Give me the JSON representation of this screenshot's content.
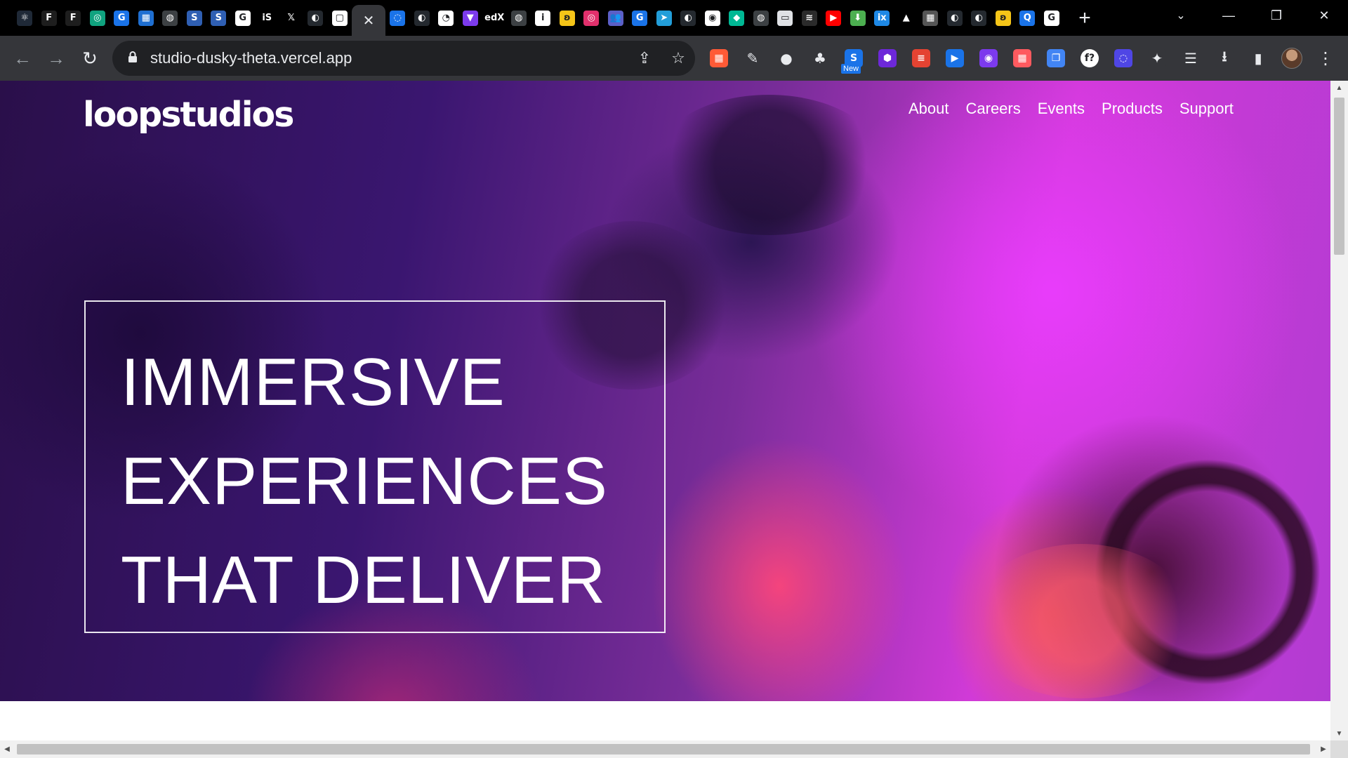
{
  "browser": {
    "tabs": [
      {
        "icon": "react-icon",
        "color": "#1f2937",
        "glyph": "⚛"
      },
      {
        "icon": "figma-icon",
        "color": "#1e1e1e",
        "glyph": "F"
      },
      {
        "icon": "figma-icon",
        "color": "#1e1e1e",
        "glyph": "F"
      },
      {
        "icon": "chatgpt-icon",
        "color": "#10a37f",
        "glyph": "◎"
      },
      {
        "icon": "grammarly-icon",
        "color": "#1a73e8",
        "glyph": "G"
      },
      {
        "icon": "windows-icon",
        "color": "#1f6fd1",
        "glyph": "▦"
      },
      {
        "icon": "globe-icon",
        "color": "#3c4043",
        "glyph": "◍"
      },
      {
        "icon": "s-icon",
        "color": "#2f5fb3",
        "glyph": "S"
      },
      {
        "icon": "s-icon",
        "color": "#2f5fb3",
        "glyph": "S"
      },
      {
        "icon": "google-icon",
        "color": "#ffffff",
        "glyph": "G"
      },
      {
        "icon": "is-icon",
        "color": "#000000",
        "glyph": "iS"
      },
      {
        "icon": "x-icon",
        "color": "#000000",
        "glyph": "𝕏"
      },
      {
        "icon": "github-icon",
        "color": "#24292f",
        "glyph": "◐"
      },
      {
        "icon": "document-icon",
        "color": "#ffffff",
        "glyph": "▢"
      },
      {
        "icon": "close-icon",
        "color": "#35363a",
        "glyph": "✕",
        "active": true
      },
      {
        "icon": "loader-icon",
        "color": "#1a73e8",
        "glyph": "◌"
      },
      {
        "icon": "github-icon",
        "color": "#24292f",
        "glyph": "◐"
      },
      {
        "icon": "clock-icon",
        "color": "#ffffff",
        "glyph": "◔"
      },
      {
        "icon": "vite-icon",
        "color": "#7c3aed",
        "glyph": "▼"
      },
      {
        "icon": "edx-icon",
        "color": "#000000",
        "glyph": "edX"
      },
      {
        "icon": "globe-icon",
        "color": "#3c4043",
        "glyph": "◍"
      },
      {
        "icon": "info-icon",
        "color": "#ffffff",
        "glyph": "i"
      },
      {
        "icon": "butterfly-icon",
        "color": "#f5c518",
        "glyph": "ʚ"
      },
      {
        "icon": "instagram-icon",
        "color": "#e1306c",
        "glyph": "◎"
      },
      {
        "icon": "teams-icon",
        "color": "#5b5fc7",
        "glyph": "👥"
      },
      {
        "icon": "grammarly-icon",
        "color": "#1a73e8",
        "glyph": "G"
      },
      {
        "icon": "telegram-icon",
        "color": "#229ed9",
        "glyph": "➤"
      },
      {
        "icon": "github-icon",
        "color": "#24292f",
        "glyph": "◐"
      },
      {
        "icon": "chrome-icon",
        "color": "#ffffff",
        "glyph": "◉"
      },
      {
        "icon": "diamond-icon",
        "color": "#00b894",
        "glyph": "◆"
      },
      {
        "icon": "globe-icon",
        "color": "#3c4043",
        "glyph": "◍"
      },
      {
        "icon": "chat-icon",
        "color": "#dfe1e5",
        "glyph": "▭"
      },
      {
        "icon": "flag-icon",
        "color": "#2b2b2b",
        "glyph": "≋"
      },
      {
        "icon": "youtube-icon",
        "color": "#ff0000",
        "glyph": "▶"
      },
      {
        "icon": "download-arrow-icon",
        "color": "#4caf50",
        "glyph": "⬇"
      },
      {
        "icon": "ix-icon",
        "color": "#1e88e5",
        "glyph": "ix"
      },
      {
        "icon": "triangle-icon",
        "color": "#000000",
        "glyph": "▲"
      },
      {
        "icon": "image-icon",
        "color": "#555555",
        "glyph": "▦"
      },
      {
        "icon": "github-icon",
        "color": "#24292f",
        "glyph": "◐"
      },
      {
        "icon": "github-icon",
        "color": "#24292f",
        "glyph": "◐"
      },
      {
        "icon": "butterfly-icon",
        "color": "#f5c518",
        "glyph": "ʚ"
      },
      {
        "icon": "search-blue-icon",
        "color": "#1a73e8",
        "glyph": "Q"
      },
      {
        "icon": "google-icon",
        "color": "#ffffff",
        "glyph": "G"
      }
    ],
    "new_tab_label": "+",
    "window_controls": {
      "minimize": "—",
      "restore": "❐",
      "close": "✕",
      "tab_search": "⌄"
    },
    "toolbar": {
      "back": "←",
      "forward": "→",
      "reload": "↻",
      "url": "studio-dusky-theta.vercel.app",
      "share": "⇪",
      "bookmark": "☆"
    },
    "extensions": [
      {
        "icon": "color-picker-icon",
        "color": "#ff5a36",
        "glyph": "▦"
      },
      {
        "icon": "pencil-icon",
        "color": "#35363a",
        "glyph": "✎"
      },
      {
        "icon": "mouse-icon",
        "color": "#35363a",
        "glyph": "●"
      },
      {
        "icon": "tree-icon",
        "color": "#35363a",
        "glyph": "♣"
      },
      {
        "icon": "s-extension-icon",
        "color": "#1a73e8",
        "glyph": "S",
        "badge": "New"
      },
      {
        "icon": "shield-icon",
        "color": "#6d28d9",
        "glyph": "⬢"
      },
      {
        "icon": "todoist-icon",
        "color": "#e44332",
        "glyph": "≡"
      },
      {
        "icon": "tab-icon",
        "color": "#1a73e8",
        "glyph": "▶"
      },
      {
        "icon": "cursor-icon",
        "color": "#7c3aed",
        "glyph": "◉"
      },
      {
        "icon": "calendar-icon",
        "color": "#ff5a5f",
        "glyph": "▦"
      },
      {
        "icon": "copy-icon",
        "color": "#4285f4",
        "glyph": "❐"
      },
      {
        "icon": "font-icon",
        "color": "#ffffff",
        "glyph": "f?"
      },
      {
        "icon": "swirl-icon",
        "color": "#4f46e5",
        "glyph": "◌"
      },
      {
        "icon": "puzzle-icon",
        "color": "#35363a",
        "glyph": "✦"
      },
      {
        "icon": "reading-list-icon",
        "color": "#35363a",
        "glyph": "☰"
      },
      {
        "icon": "download-icon",
        "color": "#35363a",
        "glyph": "⭳"
      },
      {
        "icon": "sidepanel-icon",
        "color": "#35363a",
        "glyph": "▮"
      }
    ],
    "menu": "⋮"
  },
  "site": {
    "logo": "loopstudios",
    "nav": [
      "About",
      "Careers",
      "Events",
      "Products",
      "Support"
    ],
    "headline": [
      "IMMERSIVE",
      "EXPERIENCES",
      "THAT DELIVER"
    ],
    "colors": {
      "headline": "#ffffff",
      "box_border": "#ffffff"
    }
  }
}
